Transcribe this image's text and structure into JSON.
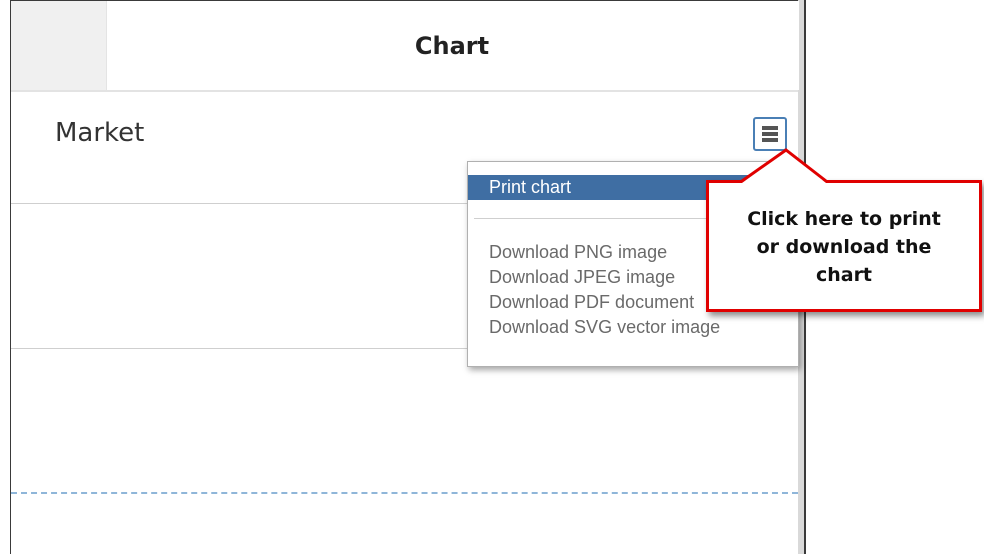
{
  "header": {
    "title": "Chart"
  },
  "chart": {
    "title": "Market",
    "menu_icon": "hamburger-menu-icon"
  },
  "context_menu": {
    "items": [
      {
        "label": "Print chart",
        "active": true
      },
      {
        "label": "Download PNG image",
        "active": false
      },
      {
        "label": "Download JPEG image",
        "active": false
      },
      {
        "label": "Download PDF document",
        "active": false
      },
      {
        "label": "Download SVG vector image",
        "active": false
      }
    ]
  },
  "callout": {
    "lines": [
      "Click here to print",
      "or download the",
      "chart"
    ]
  },
  "colors": {
    "menu_highlight": "#3f6ea3",
    "callout_border": "#e00000",
    "menu_button_border": "#4a7fb5",
    "plot_line": "#8fb6d9"
  }
}
